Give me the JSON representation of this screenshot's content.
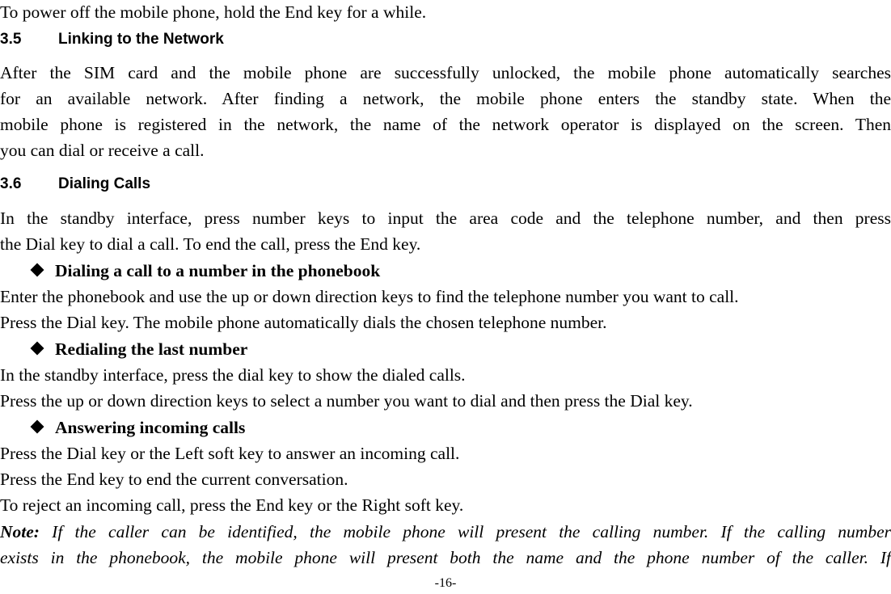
{
  "document": {
    "intro_line": "To power off the mobile phone, hold the End key for a while.",
    "sections": [
      {
        "number": "3.5",
        "title": "Linking to the Network",
        "paragraph_lines": [
          "After the SIM card and the mobile phone are successfully unlocked, the mobile phone automatically searches",
          "for an available network. After finding a network, the mobile phone enters the standby state. When the",
          "mobile phone is registered in the network, the name of the network operator is displayed on the screen. Then",
          "you can dial or receive a call."
        ]
      },
      {
        "number": "3.6",
        "title": "Dialing Calls",
        "paragraph_lines": [
          "In the standby interface, press number keys to input the area code and the telephone number, and then press",
          "the Dial key to dial a call. To end the call, press the End key."
        ],
        "subsections": [
          {
            "title": "Dialing a call to a number in the phonebook",
            "lines": [
              "Enter the phonebook and use the up or down direction keys to find the telephone number you want to call.",
              "Press the Dial key. The mobile phone automatically dials the chosen telephone number."
            ]
          },
          {
            "title": "Redialing the last number",
            "lines": [
              "In the standby interface, press the dial key to show the dialed calls.",
              "Press the up or down direction keys to select a number you want to dial and then press the Dial key."
            ]
          },
          {
            "title": "Answering incoming calls",
            "lines": [
              "Press the Dial key or the Left soft key to answer an incoming call.",
              "Press the End key to end the current conversation.",
              "To reject an incoming call, press the End key or the Right soft key."
            ]
          }
        ]
      }
    ],
    "note": {
      "label": "Note:",
      "line1": " If the caller can be identified, the mobile phone will present the calling number. If the calling number",
      "line2": "exists in the phonebook, the mobile phone will present both the name and the phone number of the caller. If"
    },
    "page_number": "-16-"
  }
}
